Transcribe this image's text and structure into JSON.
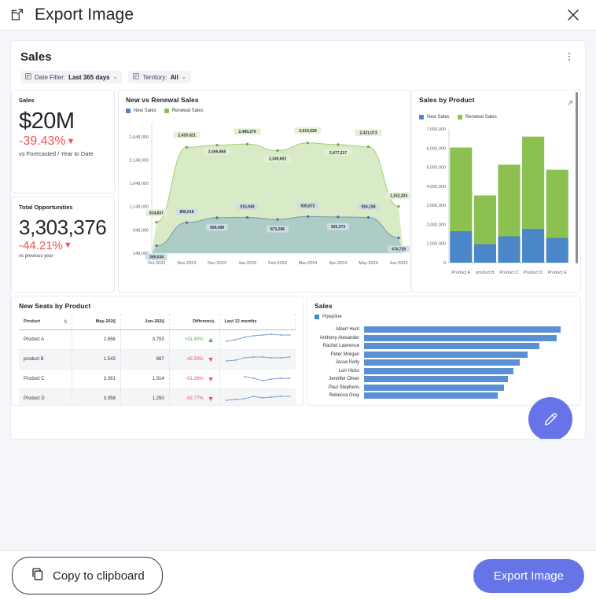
{
  "window": {
    "title": "Export Image",
    "export_icon": "external-link-icon",
    "close_icon": "close-icon"
  },
  "dashboard": {
    "title": "Sales",
    "kebab_icon": "more-vertical-icon",
    "filters": [
      {
        "icon": "filter-icon",
        "label": "Date Filter:",
        "value": "Last 365 days",
        "caret": "⌄"
      },
      {
        "icon": "filter-icon",
        "label": "Territory:",
        "value": "All",
        "caret": "⌄"
      }
    ],
    "kpi_sales": {
      "label": "Sales",
      "value": "$20M",
      "delta": "-39.43%",
      "delta_dir": "▼",
      "sub": "vs Forecasted / Year to Date",
      "delta_color": "#ef5350"
    },
    "kpi_opportunities": {
      "label": "Total Opportunities",
      "value": "3,303,376",
      "delta": "-44.21%",
      "delta_dir": "▼",
      "sub": "vs previous year",
      "delta_color": "#ef5350"
    },
    "area_card": {
      "title": "New vs Renewal Sales",
      "legend": [
        {
          "name": "New Sales",
          "color": "#4a86c8"
        },
        {
          "name": "Renewal Sales",
          "color": "#8cc152"
        }
      ]
    },
    "product_card": {
      "title": "Sales by Product",
      "expand_icon": "expand-arrow-icon",
      "legend": [
        {
          "name": "New Sales",
          "color": "#4a86c8"
        },
        {
          "name": "Renewal Sales",
          "color": "#8cc152"
        }
      ]
    },
    "seats_card": {
      "title": "New Seats by Product",
      "columns": [
        "Product",
        "May-2024",
        "Jun-2024",
        "Difference",
        "Last 12 months"
      ],
      "sort_icon": "sort-icon",
      "rows": [
        {
          "product": "Product A",
          "may": "2.856",
          "jun": "3.753",
          "difference": "+31.40%",
          "dir": "up"
        },
        {
          "product": "product B",
          "may": "1.543",
          "jun": "887",
          "difference": "-42.50%",
          "dir": "down"
        },
        {
          "product": "Product C",
          "may": "3.391",
          "jun": "1.314",
          "difference": "-61.26%",
          "dir": "down"
        },
        {
          "product": "Product D",
          "may": "3.358",
          "jun": "1.250",
          "difference": "-62.77%",
          "dir": "down"
        }
      ]
    },
    "pipeline_card": {
      "title": "Sales",
      "legend": [
        {
          "name": "Pipepline",
          "color": "#4a86c8"
        }
      ],
      "edit_icon": "pencil-icon"
    }
  },
  "footer": {
    "copy_label": "Copy to clipboard",
    "copy_icon": "copy-icon",
    "export_label": "Export Image",
    "primary_color": "#6674e8"
  },
  "chart_data": [
    {
      "type": "area",
      "title": "New vs Renewal Sales",
      "xlabel": "",
      "ylabel": "",
      "grid": false,
      "legend_position": "top-left",
      "x": [
        "Oct-2023",
        "Nov-2023",
        "Dec-2023",
        "Jan-2024",
        "Feb-2024",
        "Mar-2024",
        "Apr-2024",
        "May-2024",
        "Jun-2024"
      ],
      "ylim": [
        148000,
        2948000
      ],
      "yticks": [
        "148,000",
        "648,000",
        "1,148,000",
        "1,648,000",
        "2,148,000",
        "2,648,000"
      ],
      "ytick_values": [
        148000,
        648000,
        1148000,
        1648000,
        2148000,
        2648000
      ],
      "series": [
        {
          "name": "Renewal Sales",
          "color": "#8cc152",
          "values": [
            814837,
            2420321,
            2466868,
            2489276,
            2349602,
            2513029,
            2477217,
            2431073,
            1152324
          ],
          "labels": [
            "814,837",
            "2,420,321",
            "2,466,868",
            "2,489,276",
            "2,349,602",
            "2,513,029",
            "2,477,217",
            "2,431,073",
            "1,152,324"
          ]
        },
        {
          "name": "New Sales",
          "color": "#4a86c8",
          "values": [
            309034,
            806018,
            909499,
            915949,
            873286,
            935872,
            926373,
            916158,
            476729
          ],
          "labels": [
            "309,034",
            "806,018",
            "909,499",
            "915,949",
            "873,286",
            "935,872",
            "926,373",
            "916,158",
            "476,729"
          ]
        }
      ]
    },
    {
      "type": "bar",
      "title": "Sales by Product",
      "stacked": true,
      "xlabel": "",
      "ylabel": "",
      "grid": false,
      "legend_position": "top-left",
      "categories": [
        "Product A",
        "product B",
        "Product C",
        "Product D",
        "Product E"
      ],
      "ylim": [
        0,
        7000000
      ],
      "yticks": [
        "0",
        "1,000,000",
        "2,000,000",
        "3,000,000",
        "4,000,000",
        "5,000,000",
        "6,000,000",
        "7,000,000"
      ],
      "ytick_values": [
        0,
        1000000,
        2000000,
        3000000,
        4000000,
        5000000,
        6000000,
        7000000
      ],
      "series": [
        {
          "name": "New Sales",
          "color": "#4a86c8",
          "values": [
            1650000,
            980000,
            1380000,
            1780000,
            1300000
          ]
        },
        {
          "name": "Renewal Sales",
          "color": "#8cc152",
          "values": [
            4380000,
            2540000,
            3750000,
            4820000,
            3570000
          ]
        }
      ]
    },
    {
      "type": "bar",
      "title": "Sales",
      "orientation": "horizontal",
      "legend_position": "top-left",
      "categories": [
        "Albert Hunt",
        "Anthony Alexander",
        "Rachel Lawrence",
        "Peter Morgan",
        "Jesse Kelly",
        "Lori Hicks",
        "Jennifer Oliver",
        "Paul Stephens",
        "Rebecca Gray"
      ],
      "series": [
        {
          "name": "Pipepline",
          "color": "#4a86c8",
          "values": [
            100,
            98,
            89,
            83,
            79,
            76,
            73,
            71,
            68
          ]
        }
      ]
    },
    {
      "type": "table",
      "title": "New Seats by Product",
      "columns": [
        "Product",
        "May-2024",
        "Jun-2024",
        "Difference",
        "Last 12 months"
      ],
      "rows": [
        [
          "Product A",
          "2.856",
          "3.753",
          "+31.40%",
          "sparkline-up"
        ],
        [
          "product B",
          "1.543",
          "887",
          "-42.50%",
          "sparkline-flat"
        ],
        [
          "Product C",
          "3.391",
          "1.314",
          "-61.26%",
          "sparkline-dip"
        ],
        [
          "Product D",
          "3.358",
          "1.250",
          "-62.77%",
          "sparkline-wave"
        ]
      ]
    }
  ]
}
